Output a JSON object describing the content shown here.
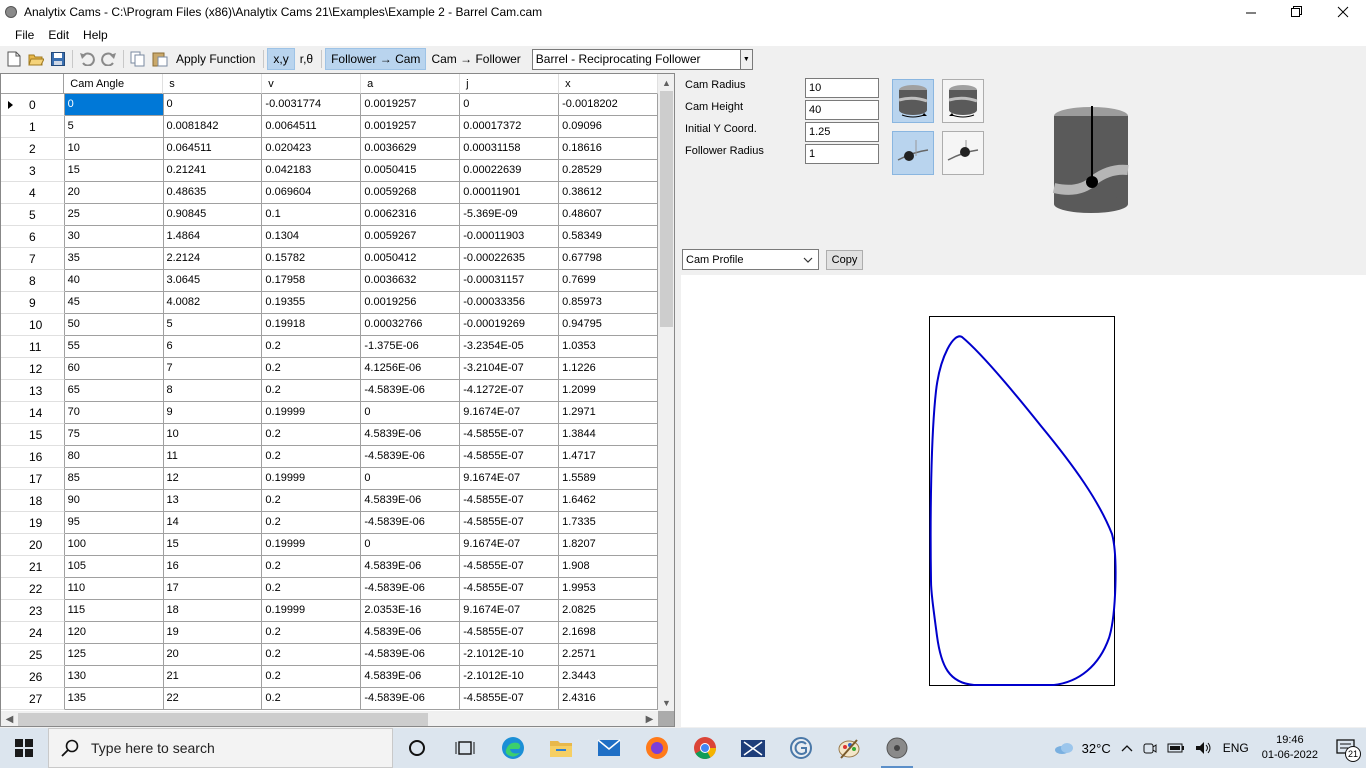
{
  "window": {
    "title": "Analytix Cams - C:\\Program Files (x86)\\Analytix Cams 21\\Examples\\Example 2 - Barrel Cam.cam"
  },
  "menu": [
    "File",
    "Edit",
    "Help"
  ],
  "toolbar": {
    "apply_function": "Apply Function",
    "coord_xy": "x,y",
    "coord_rtheta": "r,θ",
    "follower_to_cam": "Follower → Cam",
    "cam_to_follower": "Cam → Follower",
    "mode": "Barrel - Reciprocating Follower"
  },
  "grid": {
    "columns": [
      "Cam Angle",
      "s",
      "v",
      "a",
      "j",
      "x"
    ],
    "rows": [
      [
        "0",
        "0",
        "0",
        "-0.0031774",
        "0.0019257",
        "0",
        "-0.0018202"
      ],
      [
        "1",
        "5",
        "0.0081842",
        "0.0064511",
        "0.0019257",
        "0.00017372",
        "0.09096"
      ],
      [
        "2",
        "10",
        "0.064511",
        "0.020423",
        "0.0036629",
        "0.00031158",
        "0.18616"
      ],
      [
        "3",
        "15",
        "0.21241",
        "0.042183",
        "0.0050415",
        "0.00022639",
        "0.28529"
      ],
      [
        "4",
        "20",
        "0.48635",
        "0.069604",
        "0.0059268",
        "0.00011901",
        "0.38612"
      ],
      [
        "5",
        "25",
        "0.90845",
        "0.1",
        "0.0062316",
        "-5.369E-09",
        "0.48607"
      ],
      [
        "6",
        "30",
        "1.4864",
        "0.1304",
        "0.0059267",
        "-0.00011903",
        "0.58349"
      ],
      [
        "7",
        "35",
        "2.2124",
        "0.15782",
        "0.0050412",
        "-0.00022635",
        "0.67798"
      ],
      [
        "8",
        "40",
        "3.0645",
        "0.17958",
        "0.0036632",
        "-0.00031157",
        "0.7699"
      ],
      [
        "9",
        "45",
        "4.0082",
        "0.19355",
        "0.0019256",
        "-0.00033356",
        "0.85973"
      ],
      [
        "10",
        "50",
        "5",
        "0.19918",
        "0.00032766",
        "-0.00019269",
        "0.94795"
      ],
      [
        "11",
        "55",
        "6",
        "0.2",
        "-1.375E-06",
        "-3.2354E-05",
        "1.0353"
      ],
      [
        "12",
        "60",
        "7",
        "0.2",
        "4.1256E-06",
        "-3.2104E-07",
        "1.1226"
      ],
      [
        "13",
        "65",
        "8",
        "0.2",
        "-4.5839E-06",
        "-4.1272E-07",
        "1.2099"
      ],
      [
        "14",
        "70",
        "9",
        "0.19999",
        "0",
        "9.1674E-07",
        "1.2971"
      ],
      [
        "15",
        "75",
        "10",
        "0.2",
        "4.5839E-06",
        "-4.5855E-07",
        "1.3844"
      ],
      [
        "16",
        "80",
        "11",
        "0.2",
        "-4.5839E-06",
        "-4.5855E-07",
        "1.4717"
      ],
      [
        "17",
        "85",
        "12",
        "0.19999",
        "0",
        "9.1674E-07",
        "1.5589"
      ],
      [
        "18",
        "90",
        "13",
        "0.2",
        "4.5839E-06",
        "-4.5855E-07",
        "1.6462"
      ],
      [
        "19",
        "95",
        "14",
        "0.2",
        "-4.5839E-06",
        "-4.5855E-07",
        "1.7335"
      ],
      [
        "20",
        "100",
        "15",
        "0.19999",
        "0",
        "9.1674E-07",
        "1.8207"
      ],
      [
        "21",
        "105",
        "16",
        "0.2",
        "4.5839E-06",
        "-4.5855E-07",
        "1.908"
      ],
      [
        "22",
        "110",
        "17",
        "0.2",
        "-4.5839E-06",
        "-4.5855E-07",
        "1.9953"
      ],
      [
        "23",
        "115",
        "18",
        "0.19999",
        "2.0353E-16",
        "9.1674E-07",
        "2.0825"
      ],
      [
        "24",
        "120",
        "19",
        "0.2",
        "4.5839E-06",
        "-4.5855E-07",
        "2.1698"
      ],
      [
        "25",
        "125",
        "20",
        "0.2",
        "-4.5839E-06",
        "-2.1012E-10",
        "2.2571"
      ],
      [
        "26",
        "130",
        "21",
        "0.2",
        "4.5839E-06",
        "-2.1012E-10",
        "2.3443"
      ],
      [
        "27",
        "135",
        "22",
        "0.2",
        "-4.5839E-06",
        "-4.5855E-07",
        "2.4316"
      ]
    ]
  },
  "params": [
    {
      "label": "Cam Radius",
      "value": "10"
    },
    {
      "label": "Cam Height",
      "value": "40"
    },
    {
      "label": "Initial Y Coord.",
      "value": "1.25"
    },
    {
      "label": "Follower Radius",
      "value": "1"
    }
  ],
  "profile": {
    "selected": "Cam Profile",
    "copy_label": "Copy"
  },
  "taskbar": {
    "search_placeholder": "Type here to search",
    "weather": "32°C",
    "language": "ENG",
    "time": "19:46",
    "date": "01-06-2022",
    "notifications": "21"
  },
  "colors": {
    "selection": "#0078d7",
    "profile_curve": "#0000cc",
    "active_button": "#b9d4ee"
  }
}
